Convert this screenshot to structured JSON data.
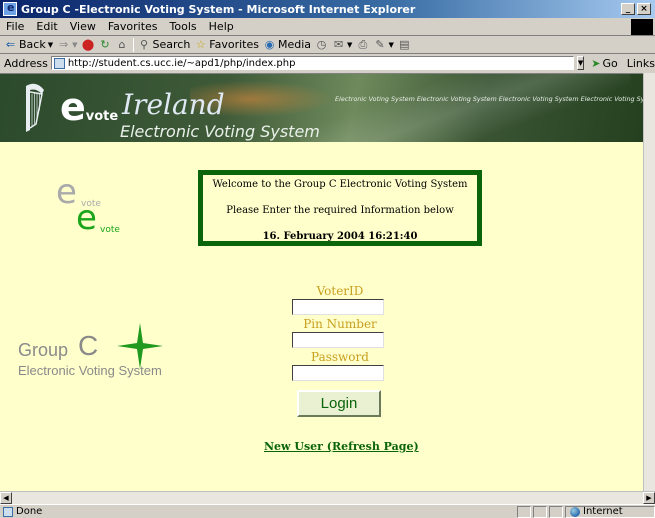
{
  "window": {
    "title": "Group C -Electronic Voting System - Microsoft Internet Explorer",
    "buttons": [
      "_",
      "×"
    ]
  },
  "menu": [
    "File",
    "Edit",
    "View",
    "Favorites",
    "Tools",
    "Help"
  ],
  "toolbar": {
    "back": "Back",
    "search": "Search",
    "favorites": "Favorites",
    "media": "Media"
  },
  "address": {
    "label": "Address",
    "url": "http://student.cs.ucc.ie/~apd1/php/index.php",
    "go": "Go",
    "links": "Links"
  },
  "banner": {
    "logo_e": "e",
    "logo_vote": "vote",
    "heading": "Ireland",
    "subtitle": "Electronic Voting System",
    "scroll_text": "Electronic Voting System Electronic Voting System Electronic Voting System Electronic Voting System"
  },
  "evote_logo": {
    "e": "e",
    "vote": "vote"
  },
  "group_logo": {
    "group": "Group",
    "c": "C",
    "subtitle": "Electronic Voting System"
  },
  "welcome": {
    "line1": "Welcome to the Group C Electronic Voting System",
    "line2": "Please Enter the required Information below",
    "datetime": "16. February 2004 16:21:40"
  },
  "form": {
    "voter_id_label": "VoterID",
    "pin_label": "Pin Number",
    "password_label": "Password",
    "voter_id_value": "",
    "pin_value": "",
    "password_value": "",
    "login_label": "Login",
    "new_user_link": "New User (Refresh Page)"
  },
  "status": {
    "text": "Done",
    "zone": "Internet"
  }
}
